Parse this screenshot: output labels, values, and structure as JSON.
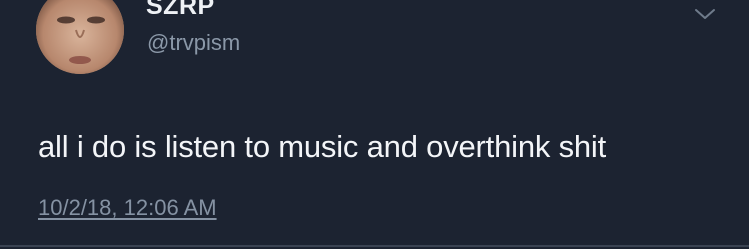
{
  "user": {
    "display_name": "SZRP",
    "handle": "@trvpism"
  },
  "tweet": {
    "text": "all i do is listen to music and overthink shit",
    "timestamp": "10/2/18, 12:06 AM"
  },
  "icons": {
    "menu": "chevron-down-icon"
  },
  "colors": {
    "background": "#1c2331",
    "primary_text": "#f3f5f8",
    "secondary_text": "#8b98a8"
  }
}
